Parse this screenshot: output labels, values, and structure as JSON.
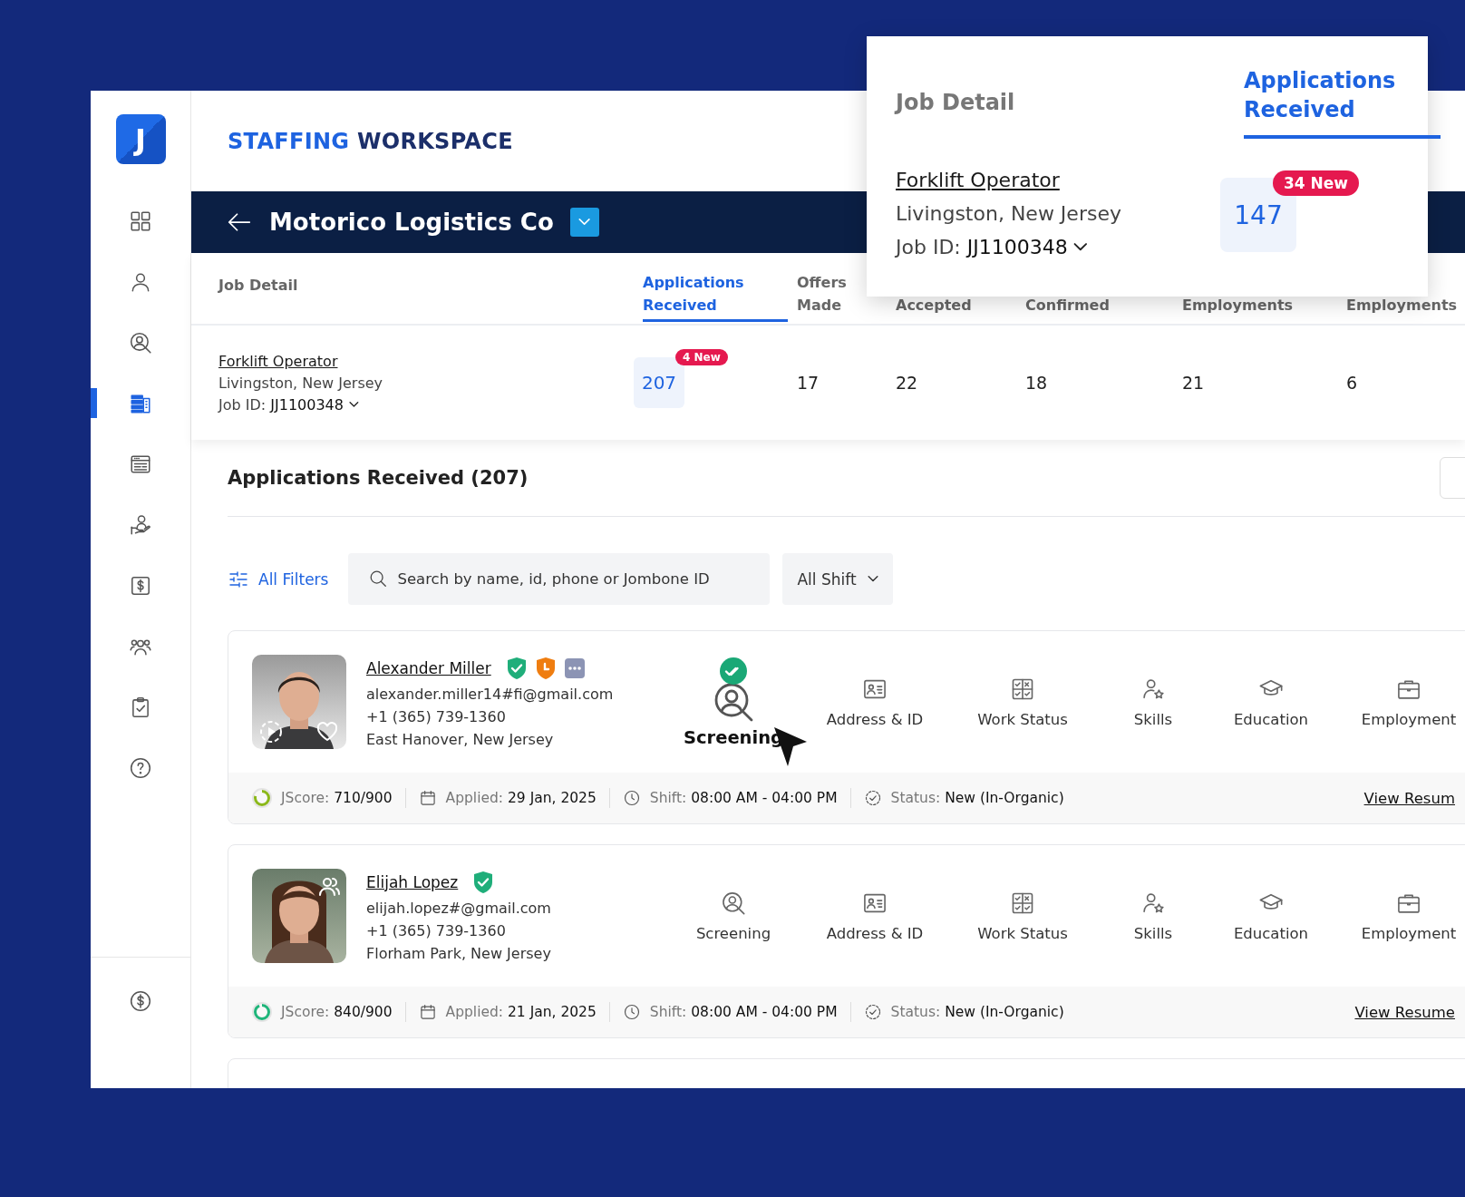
{
  "sidebar": {
    "logo": "J",
    "items": [
      {
        "kind": "grid",
        "selected": false
      },
      {
        "kind": "person",
        "selected": false
      },
      {
        "kind": "person-search",
        "selected": false
      },
      {
        "kind": "list",
        "selected": true
      },
      {
        "kind": "window",
        "selected": false
      },
      {
        "kind": "hand-person",
        "selected": false
      },
      {
        "kind": "dollar",
        "selected": false
      },
      {
        "kind": "people",
        "selected": false
      },
      {
        "kind": "clipboard",
        "selected": false
      },
      {
        "kind": "help",
        "selected": false
      }
    ],
    "footer_items": [
      {
        "kind": "coin",
        "selected": false
      }
    ]
  },
  "workspace_title": {
    "accent": "STAFFING",
    "rest": "WORKSPACE"
  },
  "company_bar": {
    "name": "Motorico Logistics Co"
  },
  "job_table": {
    "columns": [
      {
        "label": "Job Detail",
        "selected": false
      },
      {
        "label": "Applications Received",
        "selected": true
      },
      {
        "label": "Offers Made",
        "selected": false
      },
      {
        "label": "Accepted",
        "selected": false
      },
      {
        "label": "Confirmed",
        "selected": false
      },
      {
        "label": "Employments",
        "selected": false
      },
      {
        "label": "Employments",
        "selected": false
      }
    ],
    "row": {
      "title": "Forklift Operator",
      "location": "Livingston, New Jersey",
      "job_id_label": "Job ID:",
      "job_id": "JJ1100348",
      "cells": [
        {
          "value": "207",
          "badge": "4 New"
        },
        {
          "value": "17"
        },
        {
          "value": "22"
        },
        {
          "value": "18"
        },
        {
          "value": "21"
        },
        {
          "value": "6"
        }
      ]
    }
  },
  "popup": {
    "columns": [
      {
        "label": "Job Detail",
        "selected": false
      },
      {
        "label": "Applications Received",
        "selected": true
      }
    ],
    "title": "Forklift Operator",
    "location": "Livingston, New Jersey",
    "job_id_label": "Job ID:",
    "job_id": "JJ1100348",
    "count": "147",
    "badge": "34 New"
  },
  "applications": {
    "title": "Applications Received (207)",
    "filters": "All Filters",
    "search": {
      "placeholder": "Search by name, id, phone or Jombone ID"
    },
    "shift": "All Shift",
    "candidates": [
      {
        "name": "Alexander Miller",
        "badges": [
          {
            "kind": "verified"
          },
          {
            "kind": "clock"
          },
          {
            "kind": "more"
          }
        ],
        "photo_icons": [
          {
            "kind": "play"
          },
          {
            "kind": "heart"
          }
        ],
        "email": "alexander.miller14#fi@gmail.com",
        "phone": "+1 (365) 739-1360",
        "location": "East Hanover, New Jersey",
        "steps": [
          {
            "kind": "screening",
            "label": "Screening",
            "selected": true
          },
          {
            "kind": "address",
            "label": "Address & ID",
            "selected": false
          },
          {
            "kind": "work",
            "label": "Work Status",
            "selected": false
          },
          {
            "kind": "skills",
            "label": "Skills",
            "selected": false
          },
          {
            "kind": "education",
            "label": "Education",
            "selected": false
          },
          {
            "kind": "employment",
            "label": "Employment",
            "selected": false
          }
        ],
        "score_label": "JScore:",
        "score": "710/900",
        "level": 0.79,
        "color": "#8bb81a",
        "applied_label": "Applied:",
        "applied": "29 Jan, 2025",
        "shift_label": "Shift:",
        "shift": "08:00 AM - 04:00 PM",
        "status_label": "Status:",
        "status": "New (In-Organic)",
        "link": "View Resum"
      },
      {
        "name": "Elijah Lopez",
        "badges": [
          {
            "kind": "verified"
          }
        ],
        "photo_icons": [
          {
            "kind": "people"
          }
        ],
        "email": "elijah.lopez#@gmail.com",
        "phone": "+1 (365) 739-1360",
        "location": "Florham Park, New Jersey",
        "steps": [
          {
            "kind": "screening",
            "label": "Screening",
            "selected": false
          },
          {
            "kind": "address",
            "label": "Address & ID",
            "selected": false
          },
          {
            "kind": "work",
            "label": "Work Status",
            "selected": false
          },
          {
            "kind": "skills",
            "label": "Skills",
            "selected": false
          },
          {
            "kind": "education",
            "label": "Education",
            "selected": false
          },
          {
            "kind": "employment",
            "label": "Employment",
            "selected": false
          }
        ],
        "score_label": "JScore:",
        "score": "840/900",
        "level": 0.93,
        "color": "#1fb57a",
        "applied_label": "Applied:",
        "applied": "21 Jan, 2025",
        "shift_label": "Shift:",
        "shift": "08:00 AM - 04:00 PM",
        "status_label": "Status:",
        "status": "New (In-Organic)",
        "link": "View Resume"
      }
    ]
  }
}
